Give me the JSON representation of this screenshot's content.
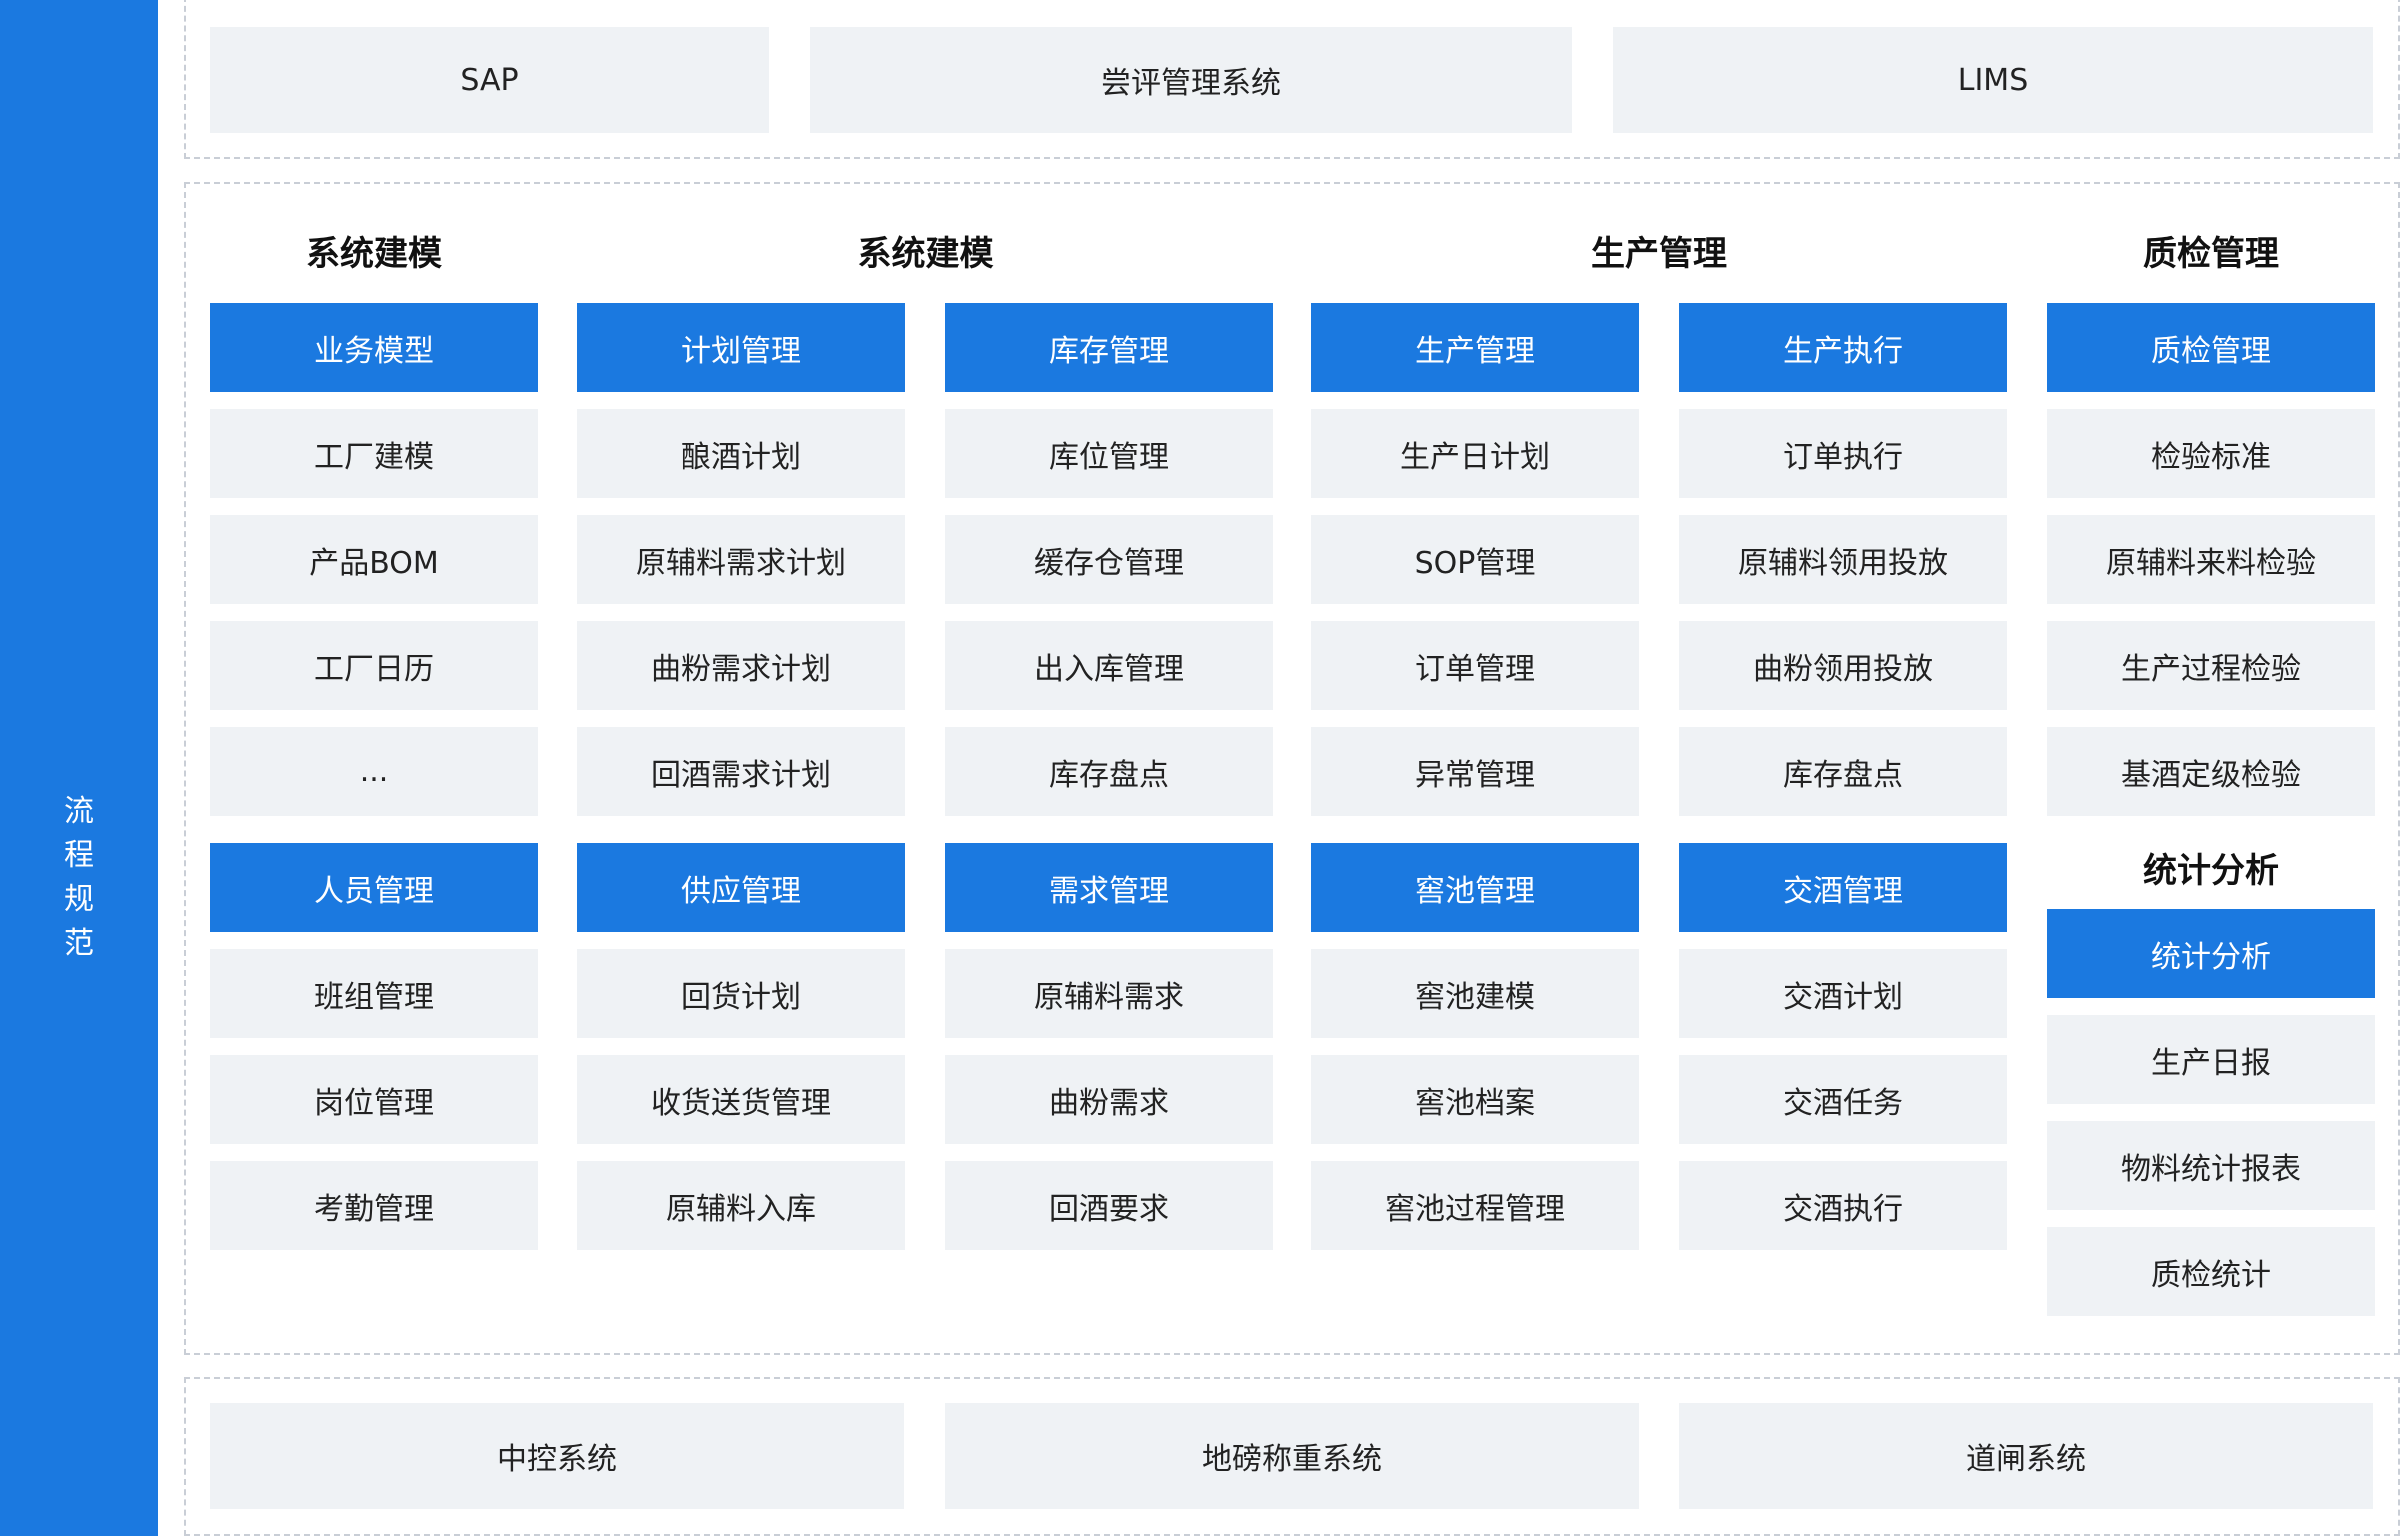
{
  "colors": {
    "accent": "#1b79e0",
    "cell_bg": "#eff2f5",
    "dash": "#c9ced6"
  },
  "side_label": "流\n程\n规\n范",
  "top_systems": [
    "SAP",
    "尝评管理系统",
    "LIMS"
  ],
  "section_titles": [
    "系统建模",
    "系统建模",
    "生产管理",
    "质检管理",
    "统计分析"
  ],
  "columns": [
    {
      "groups": [
        {
          "header": "业务模型",
          "items": [
            "工厂建模",
            "产品BOM",
            "工厂日历",
            "..."
          ]
        },
        {
          "header": "人员管理",
          "items": [
            "班组管理",
            "岗位管理",
            "考勤管理"
          ]
        }
      ]
    },
    {
      "groups": [
        {
          "header": "计划管理",
          "items": [
            "酿酒计划",
            "原辅料需求计划",
            "曲粉需求计划",
            "回酒需求计划"
          ]
        },
        {
          "header": "供应管理",
          "items": [
            "回货计划",
            "收货送货管理",
            "原辅料入库"
          ]
        }
      ]
    },
    {
      "groups": [
        {
          "header": "库存管理",
          "items": [
            "库位管理",
            "缓存仓管理",
            "出入库管理",
            "库存盘点"
          ]
        },
        {
          "header": "需求管理",
          "items": [
            "原辅料需求",
            "曲粉需求",
            "回酒要求"
          ]
        }
      ]
    },
    {
      "groups": [
        {
          "header": "生产管理",
          "items": [
            "生产日计划",
            "SOP管理",
            "订单管理",
            "异常管理"
          ]
        },
        {
          "header": "窖池管理",
          "items": [
            "窖池建模",
            "窖池档案",
            "窖池过程管理"
          ]
        }
      ]
    },
    {
      "groups": [
        {
          "header": "生产执行",
          "items": [
            "订单执行",
            "原辅料领用投放",
            "曲粉领用投放",
            "库存盘点"
          ]
        },
        {
          "header": "交酒管理",
          "items": [
            "交酒计划",
            "交酒任务",
            "交酒执行"
          ]
        }
      ]
    },
    {
      "groups": [
        {
          "header": "质检管理",
          "items": [
            "检验标准",
            "原辅料来料检验",
            "生产过程检验",
            "基酒定级检验"
          ]
        },
        {
          "header": "统计分析",
          "items": [
            "生产日报",
            "物料统计报表",
            "质检统计"
          ]
        }
      ]
    }
  ],
  "bottom_systems": [
    "中控系统",
    "地磅称重系统",
    "道闸系统"
  ]
}
